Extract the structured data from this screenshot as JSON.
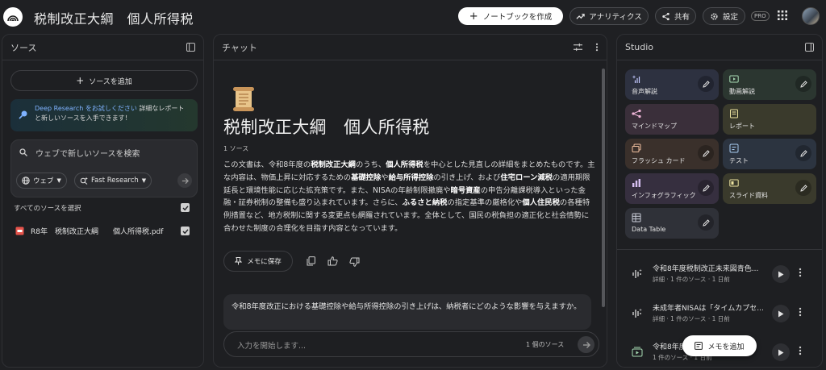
{
  "app": {
    "notebook_title": "税制改正大綱　個人所得税"
  },
  "header": {
    "create_notebook": "ノートブックを作成",
    "analytics": "アナリティクス",
    "share": "共有",
    "settings": "設定",
    "pro_badge": "PRO"
  },
  "sources": {
    "title": "ソース",
    "add_source": "ソースを追加",
    "deep_research_link": "Deep Research をお試しください",
    "deep_research_text1": "詳細なレポート",
    "deep_research_text2": "と新しいソースを入手できます！",
    "search_placeholder": "ウェブで新しいソースを検索",
    "chip_web": "ウェブ",
    "chip_research": "Fast Research",
    "select_all": "すべてのソースを選択",
    "items": [
      {
        "label": "R8年　税制改正大綱　　個人所得税.pdf",
        "checked": true
      }
    ]
  },
  "chat": {
    "title": "チャット",
    "heading": "税制改正大綱　個人所得税",
    "source_count": "1 ソース",
    "summary_parts": [
      "この文書は、令和8年度の",
      "税制改正大綱",
      "のうち、",
      "個人所得税",
      "を中心とした見直しの詳細をまとめたものです。主な内容は、物価上昇に対応するための",
      "基礎控除",
      "や",
      "給与所得控除",
      "の引き上げ、および",
      "住宅ローン減税",
      "の適用期限延長と環境性能に応じた拡充策です。また、NISAの年齢制限撤廃や",
      "暗号資産",
      "の申告分離課税導入といった金融・証券税制の整備も盛り込まれています。さらに、",
      "ふるさと納税",
      "の指定基準の厳格化や",
      "個人住民税",
      "の各種特例措置など、地方税制に関する変更点も網羅されています。全体として、国民の税負担の適正化と社会情勢に合わせた制度の合理化を目指す内容となっています。"
    ],
    "save_note": "メモに保存",
    "question": "令和8年度改正における基礎控除や給与所得控除の引き上げは、納税者にどのような影響を与えますか。",
    "input_placeholder": "入力を開始します...",
    "input_source_count": "1 個のソース"
  },
  "studio": {
    "title": "Studio",
    "tiles": [
      {
        "label": "音声解説",
        "color": "#2d3140",
        "icon": "audio-icon"
      },
      {
        "label": "動画解説",
        "color": "#2b3630",
        "icon": "video-icon"
      },
      {
        "label": "マインドマップ",
        "color": "#3a2f3a",
        "icon": "mindmap-icon"
      },
      {
        "label": "レポート",
        "color": "#3a3a2c",
        "icon": "report-icon"
      },
      {
        "label": "フラッシュ カード",
        "color": "#3a302b",
        "icon": "flashcard-icon"
      },
      {
        "label": "テスト",
        "color": "#2c3440",
        "icon": "quiz-icon"
      },
      {
        "label": "インフォグラフィック",
        "color": "#362f3f",
        "icon": "infographic-icon"
      },
      {
        "label": "スライド資料",
        "color": "#3a3a2c",
        "icon": "slides-icon"
      },
      {
        "label": "Data Table",
        "color": "#2f3138",
        "icon": "table-icon"
      }
    ],
    "notes": [
      {
        "title": "令和8年度税制改正未来図青色...",
        "sub": "詳細 · 1 件のソース · 1 日前"
      },
      {
        "title": "未成年者NISAは「タイムカプセ...",
        "sub": "詳細 · 1 件のソース · 1 日前"
      },
      {
        "title": "令和8年度",
        "sub": "1 件のソース · 1 日前"
      }
    ],
    "add_memo": "メモを追加"
  }
}
